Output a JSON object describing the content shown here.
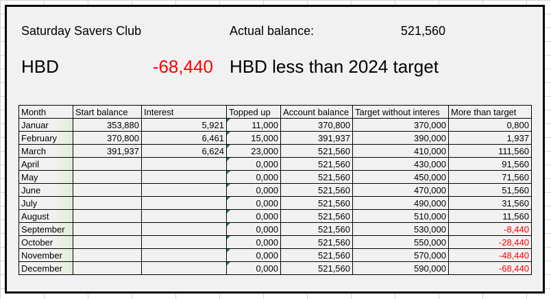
{
  "header": {
    "title": "Saturday Savers Club",
    "balance_label": "Actual balance:",
    "balance_value": "521,560",
    "hbd_label": "HBD",
    "hbd_value": "-68,440",
    "hbd_note": "HBD less than 2024 target"
  },
  "colors": {
    "negative": "#ff0000",
    "cell_flag": "#1e7b3c"
  },
  "table": {
    "columns": [
      "Month",
      "Start balance",
      "Interest",
      "Topped up",
      "Account balance",
      "Target without interes",
      "More than target"
    ],
    "rows": [
      [
        "Januar",
        "353,880",
        "5,921",
        "11,000",
        "370,800",
        "370,000",
        "0,800"
      ],
      [
        "February",
        "370,800",
        "6,461",
        "15,000",
        "391,937",
        "390,000",
        "1,937"
      ],
      [
        "March",
        "391,937",
        "6,624",
        "23,000",
        "521,560",
        "410,000",
        "111,560"
      ],
      [
        "April",
        "",
        "",
        "0,000",
        "521,560",
        "430,000",
        "91,560"
      ],
      [
        "May",
        "",
        "",
        "0,000",
        "521,560",
        "450,000",
        "71,560"
      ],
      [
        "June",
        "",
        "",
        "0,000",
        "521,560",
        "470,000",
        "51,560"
      ],
      [
        "July",
        "",
        "",
        "0,000",
        "521,560",
        "490,000",
        "31,560"
      ],
      [
        "August",
        "",
        "",
        "0,000",
        "521,560",
        "510,000",
        "11,560"
      ],
      [
        "September",
        "",
        "",
        "0,000",
        "521,560",
        "530,000",
        "-8,440"
      ],
      [
        "October",
        "",
        "",
        "0,000",
        "521,560",
        "550,000",
        "-28,440"
      ],
      [
        "November",
        "",
        "",
        "0,000",
        "521,560",
        "570,000",
        "-48,440"
      ],
      [
        "December",
        "",
        "",
        "0,000",
        "521,560",
        "590,000",
        "-68,440"
      ]
    ]
  }
}
